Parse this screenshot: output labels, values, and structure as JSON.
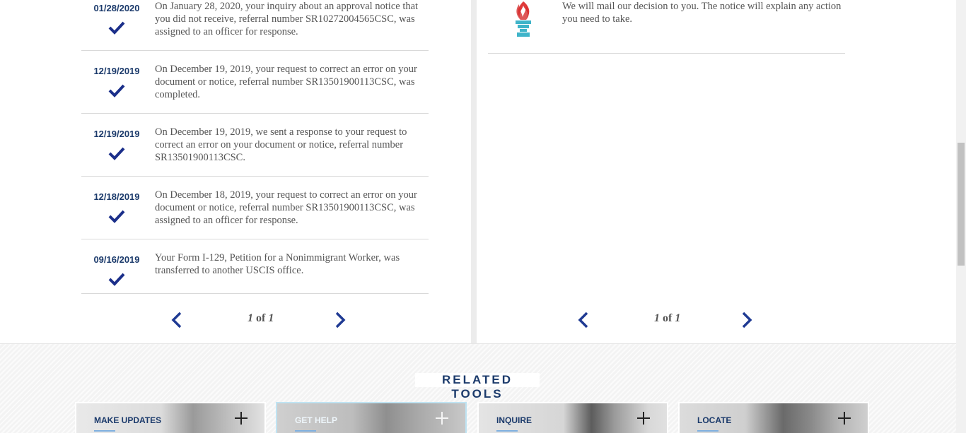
{
  "timeline": [
    {
      "date": "01/28/2020",
      "text": "On January 28, 2020, your inquiry about an approval notice that you did not receive, referral number SR10272004565CSC, was assigned to an officer for response."
    },
    {
      "date": "12/19/2019",
      "text": "On December 19, 2019, your request to correct an error on your document or notice, referral number SR13501900113CSC, was completed."
    },
    {
      "date": "12/19/2019",
      "text": "On December 19, 2019, we sent a response to your request to correct an error on your document or notice, referral number SR13501900113CSC."
    },
    {
      "date": "12/18/2019",
      "text": "On December 18, 2019, your request to correct an error on your document or notice, referral number SR13501900113CSC, was assigned to an officer for response."
    },
    {
      "date": "09/16/2019",
      "text": "Your Form I-129, Petition for a Nonimmigrant Worker, was transferred to another USCIS office."
    }
  ],
  "left_pager": {
    "current": "1",
    "of_label": "of",
    "total": "1"
  },
  "right_item": {
    "text": "We will mail our decision to you. The notice will explain any action you need to take.",
    "icon": "torch-icon"
  },
  "right_pager": {
    "current": "1",
    "of_label": "of",
    "total": "1"
  },
  "related_tools": {
    "title": "RELATED TOOLS",
    "cards": [
      {
        "label": "MAKE UPDATES",
        "active": false
      },
      {
        "label": "GET HELP",
        "active": true
      },
      {
        "label": "INQUIRE",
        "active": false
      },
      {
        "label": "LOCATE",
        "active": false
      }
    ]
  },
  "colors": {
    "navy": "#1b3a6b",
    "check": "#1b2f8a",
    "arrow": "#1f3a93",
    "torch_flame": "#e03b3b",
    "torch_base": "#3fb4c9"
  }
}
